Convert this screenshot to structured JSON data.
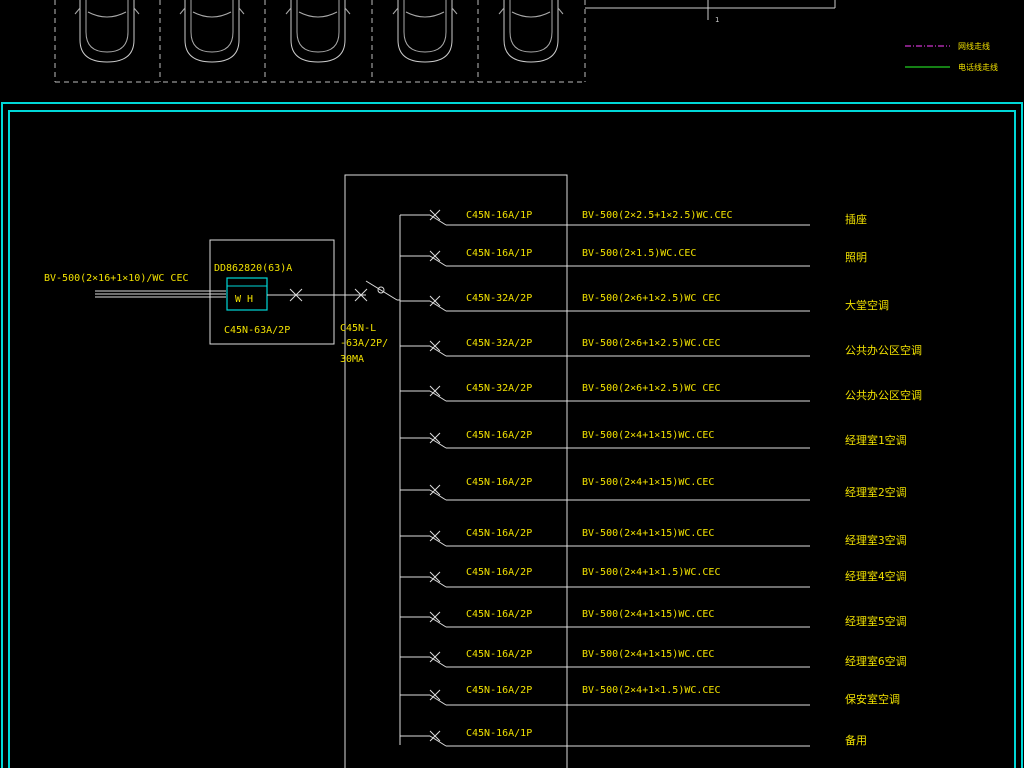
{
  "legend": {
    "items": [
      {
        "label": "网线走线",
        "color": "#cc33cc"
      },
      {
        "label": "电话线走线",
        "color": "#22cc22"
      }
    ]
  },
  "colors": {
    "background": "#000000",
    "frame": "#00d8d8",
    "text": "#f0e000",
    "line": "#e8e8e8"
  },
  "parking": {
    "cars": [
      "car-1",
      "car-2",
      "car-3",
      "car-4",
      "car-5"
    ]
  },
  "schematic": {
    "incoming_cable": "BV-500(2×16+1×10)/WC CEC",
    "meter_box": {
      "model": "DD862820(63)A",
      "meter_label": "W H",
      "breaker": "C45N-63A/2P"
    },
    "main_breaker": {
      "lines": [
        "C45N-L",
        "-63A/2P/",
        "30MA"
      ]
    },
    "circuits": [
      {
        "breaker": "C45N-16A/1P",
        "cable": "BV-500(2×2.5+1×2.5)WC.CEC",
        "load": "插座"
      },
      {
        "breaker": "C45N-16A/1P",
        "cable": "BV-500(2×1.5)WC.CEC",
        "load": "照明"
      },
      {
        "breaker": "C45N-32A/2P",
        "cable": "BV-500(2×6+1×2.5)WC CEC",
        "load": "大堂空调"
      },
      {
        "breaker": "C45N-32A/2P",
        "cable": "BV-500(2×6+1×2.5)WC.CEC",
        "load": "公共办公区空调"
      },
      {
        "breaker": "C45N-32A/2P",
        "cable": "BV-500(2×6+1×2.5)WC CEC",
        "load": "公共办公区空调"
      },
      {
        "breaker": "C45N-16A/2P",
        "cable": "BV-500(2×4+1×15)WC.CEC",
        "load": "经理室1空调"
      },
      {
        "breaker": "C45N-16A/2P",
        "cable": "BV-500(2×4+1×15)WC.CEC",
        "load": "经理室2空调"
      },
      {
        "breaker": "C45N-16A/2P",
        "cable": "BV-500(2×4+1×15)WC.CEC",
        "load": "经理室3空调"
      },
      {
        "breaker": "C45N-16A/2P",
        "cable": "BV-500(2×4+1×1.5)WC.CEC",
        "load": "经理室4空调"
      },
      {
        "breaker": "C45N-16A/2P",
        "cable": "BV-500(2×4+1×15)WC.CEC",
        "load": "经理室5空调"
      },
      {
        "breaker": "C45N-16A/2P",
        "cable": "BV-500(2×4+1×15)WC.CEC",
        "load": "经理室6空调"
      },
      {
        "breaker": "C45N-16A/2P",
        "cable": "BV-500(2×4+1×1.5)WC.CEC",
        "load": "保安室空调"
      },
      {
        "breaker": "C45N-16A/1P",
        "cable": "",
        "load": "备用"
      }
    ]
  }
}
